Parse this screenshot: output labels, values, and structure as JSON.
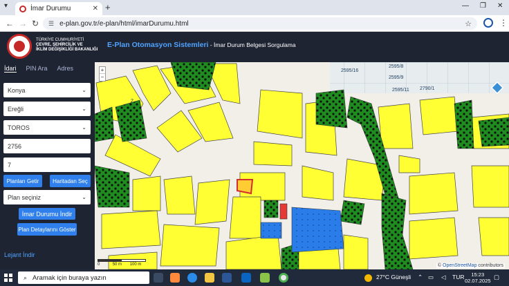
{
  "browser": {
    "tab_title": "İmar Durumu",
    "new_tab_symbol": "+",
    "url": "e-plan.gov.tr/e-plan/html/imarDurumu.html",
    "window_controls": [
      "—",
      "❐",
      "✕"
    ]
  },
  "header": {
    "ministry_line1": "TÜRKİYE CUMHURİYETİ",
    "ministry_line2": "ÇEVRE, ŞEHİRCİLİK VE",
    "ministry_line3": "İKLİM DEĞİŞİKLİĞİ BAKANLIĞI",
    "app_title": "E-Plan Otomasyon Sistemleri",
    "app_subtitle": " - İmar Durum Belgesi Sorgulama"
  },
  "sidebar": {
    "tabs": [
      {
        "label": "İdari",
        "active": true
      },
      {
        "label": "PIN Ara",
        "active": false
      },
      {
        "label": "Adres",
        "active": false
      }
    ],
    "province": "Konya",
    "district": "Ereğli",
    "neighborhood": "TOROS",
    "block": "2756",
    "parcel": "7",
    "btn_plans": "Planları Getir",
    "btn_map": "Haritadan Seç",
    "plan_select": "Plan seçiniz",
    "btn_zoning": "İmar Durumu İndir",
    "btn_details": "Plan Detaylarını Göster",
    "legend_link": "Lejant İndir"
  },
  "map": {
    "zoom_in": "+",
    "zoom_out": "−",
    "parcel_labels": [
      "2595/16",
      "2595/8",
      "2595/9",
      "2595/11",
      "2790/1",
      "2"
    ],
    "scale_labels": [
      "0",
      "50 m",
      "100 m"
    ],
    "attribution_symbol": "©",
    "attribution_osm": "OpenStreetMap",
    "attribution_rest": " contributors",
    "colors": {
      "residential": "#ffff33",
      "green": "#1e8c1e",
      "public": "#2a7de8",
      "selected": "#e53935",
      "road": "#f2efe9"
    }
  },
  "taskbar": {
    "search_placeholder": "Aramak için buraya yazın",
    "weather": "27°C  Güneşli",
    "language": "TUR",
    "time": "15:23",
    "date": "02.07.2025"
  }
}
